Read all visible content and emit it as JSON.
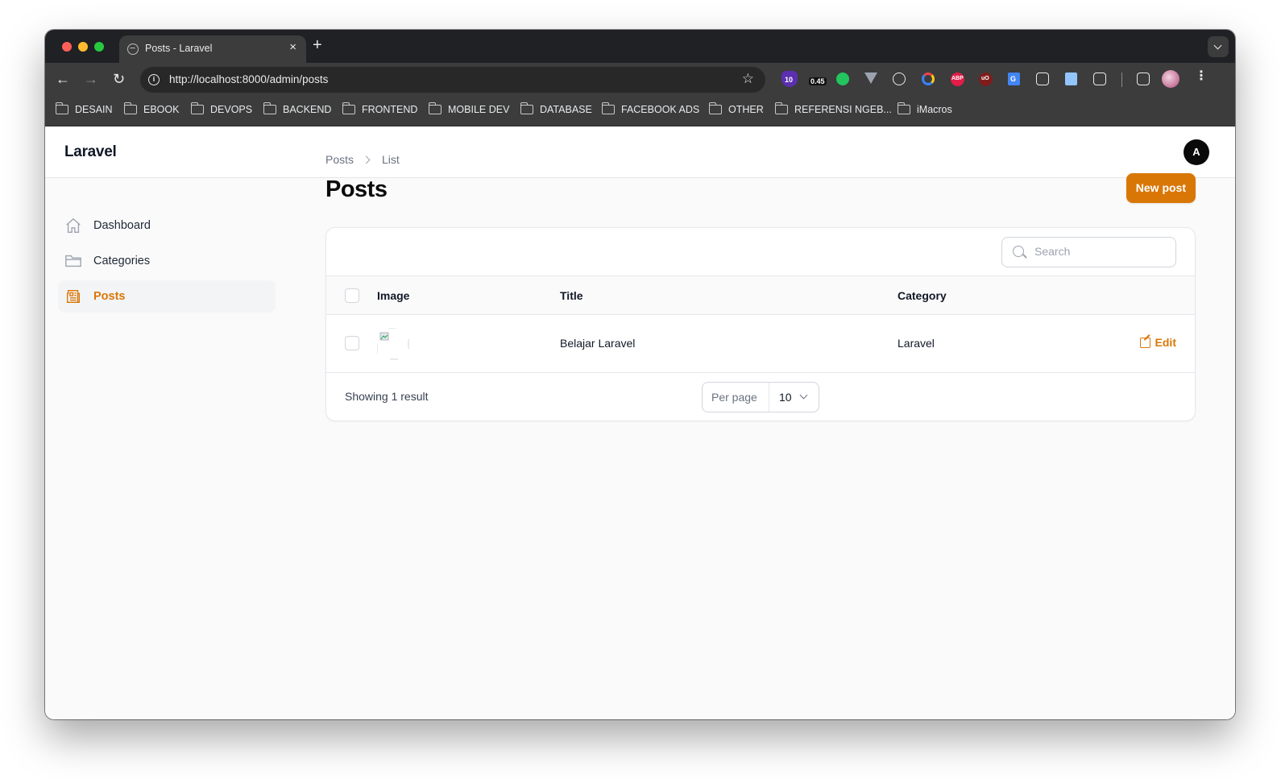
{
  "browser": {
    "tab_title": "Posts - Laravel",
    "tab_close": "×",
    "new_tab": "+",
    "url": "http://localhost:8000/admin/posts",
    "extensions": [
      {
        "name": "badge-10-ext-icon",
        "label": "10",
        "color": "#5b2fb0"
      },
      {
        "name": "counter-ext-icon",
        "label": "0.45",
        "color": "#3c3c3c"
      },
      {
        "name": "green-dot-ext-icon",
        "label": "",
        "color": "#22c55e"
      },
      {
        "name": "vue-ext-icon",
        "label": "",
        "color": "#9ca3af"
      },
      {
        "name": "react-ext-icon",
        "label": "",
        "color": "#e8eaed"
      },
      {
        "name": "color-ring-ext-icon",
        "label": "",
        "color": "#3b82f6"
      },
      {
        "name": "abp-ext-icon",
        "label": "ABP",
        "color": "#e11d48"
      },
      {
        "name": "ublock-ext-icon",
        "label": "uO",
        "color": "#7f1d1d"
      },
      {
        "name": "translate-ext-icon",
        "label": "G",
        "color": "#4285f4"
      },
      {
        "name": "expand-ext-icon",
        "label": "",
        "color": "#e8eaed"
      },
      {
        "name": "docs-ext-icon",
        "label": "",
        "color": "#93c5fd"
      },
      {
        "name": "puzzle-ext-icon",
        "label": "",
        "color": "#e8eaed"
      },
      {
        "name": "media-ext-icon",
        "label": "",
        "color": "#e8eaed"
      }
    ],
    "bookmarks": [
      "DESAIN",
      "EBOOK",
      "DEVOPS",
      "BACKEND",
      "FRONTEND",
      "MOBILE DEV",
      "DATABASE",
      "FACEBOOK ADS",
      "OTHER",
      "REFERENSI NGEB...",
      "iMacros"
    ]
  },
  "app": {
    "brand": "Laravel",
    "avatar_initial": "A"
  },
  "sidebar": {
    "items": [
      {
        "label": "Dashboard",
        "icon": "home-icon",
        "active": false
      },
      {
        "label": "Categories",
        "icon": "folder-icon",
        "active": false
      },
      {
        "label": "Posts",
        "icon": "newspaper-icon",
        "active": true
      }
    ]
  },
  "breadcrumb": {
    "items": [
      "Posts",
      "List"
    ]
  },
  "page": {
    "title": "Posts",
    "new_button": "New post"
  },
  "table": {
    "search_placeholder": "Search",
    "columns": [
      "Image",
      "Title",
      "Category"
    ],
    "rows": [
      {
        "title": "Belajar Laravel",
        "category": "Laravel",
        "action": "Edit"
      }
    ],
    "footer": {
      "showing": "Showing 1 result",
      "per_page_label": "Per page",
      "per_page_value": "10"
    }
  },
  "colors": {
    "accent": "#d97706",
    "browser_chrome": "#3c3c3c",
    "tab_bar": "#202124"
  }
}
